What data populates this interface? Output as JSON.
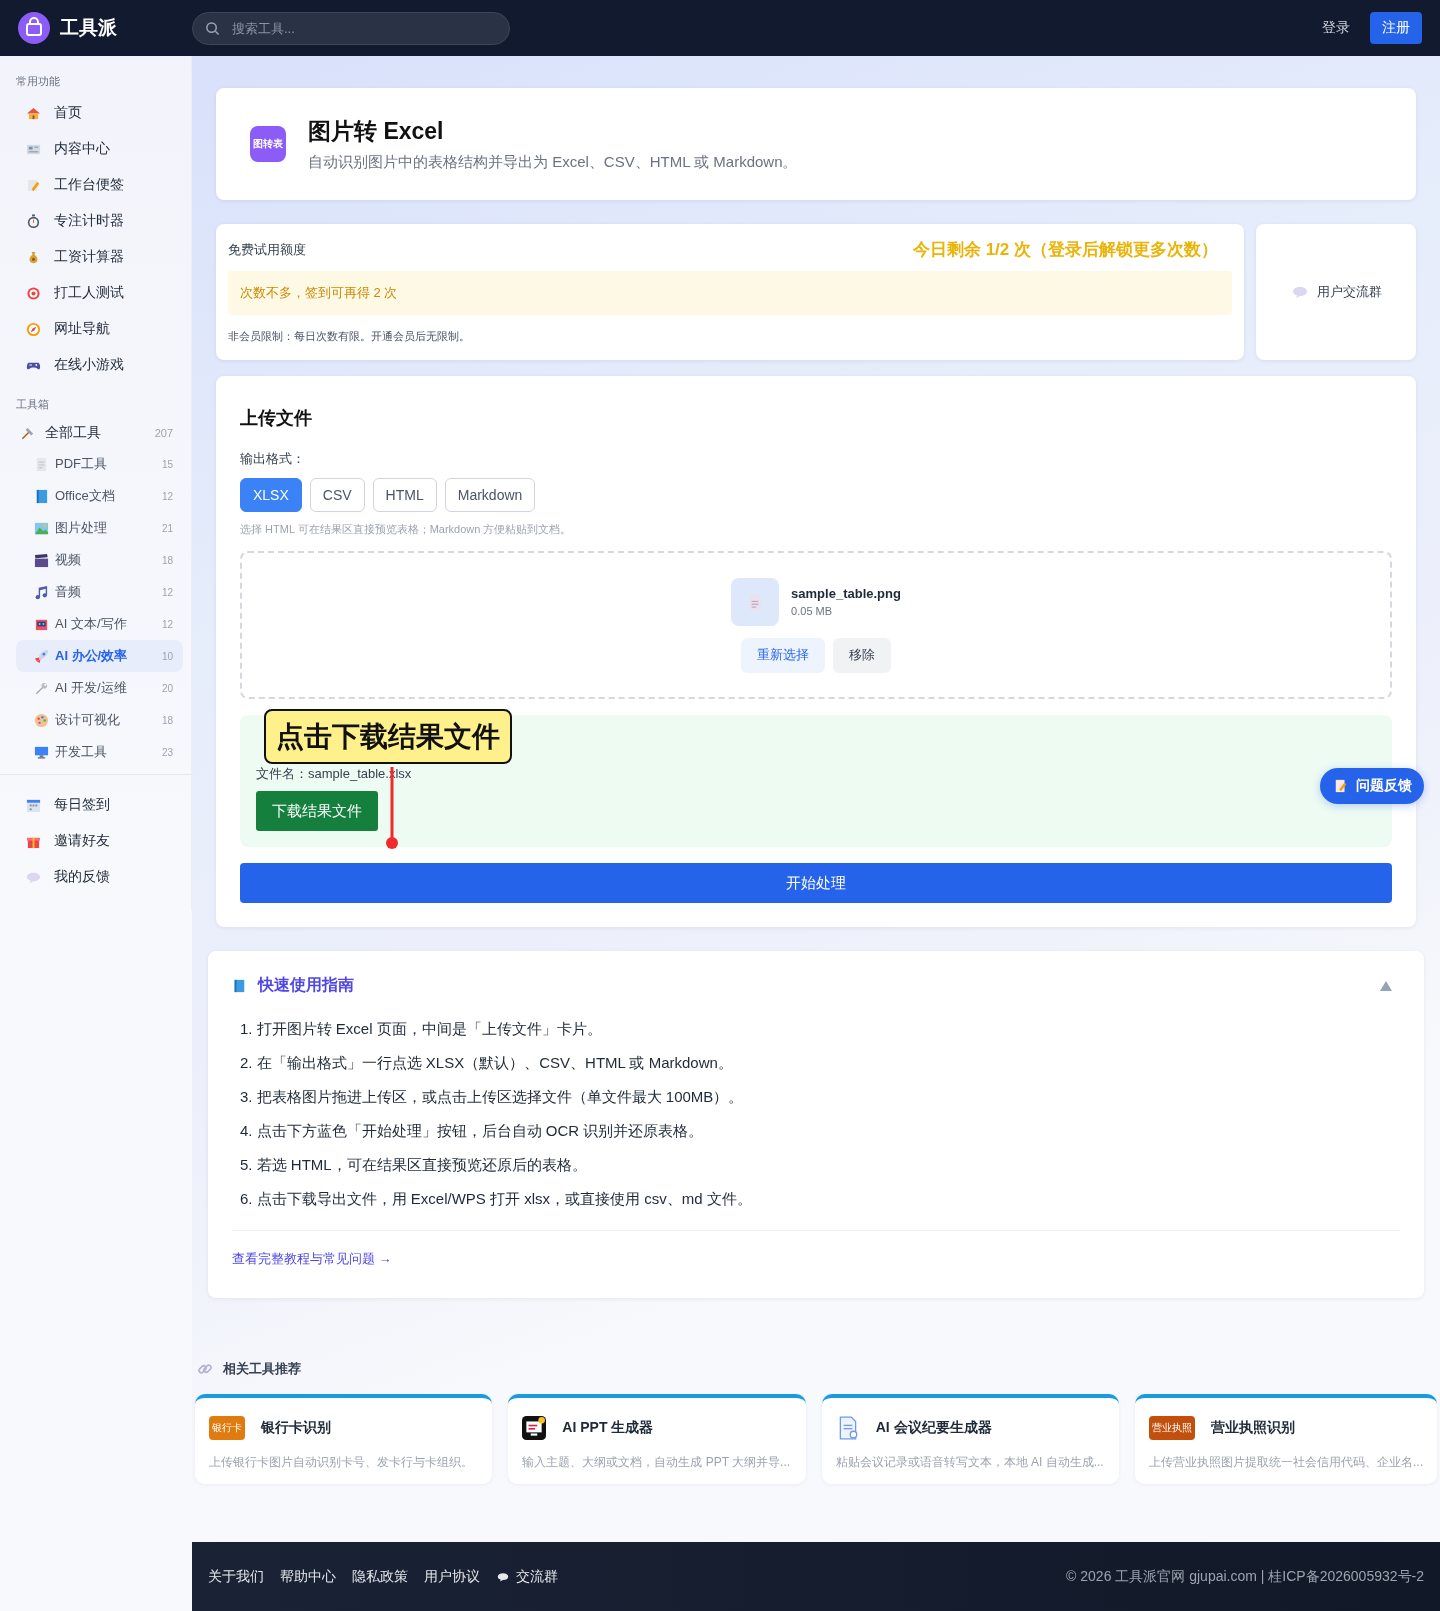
{
  "header": {
    "brand": "工具派",
    "search": {
      "placeholder": "搜索工具..."
    },
    "login": "登录",
    "register": "注册"
  },
  "sidebar": {
    "sections": [
      {
        "title": "常用功能",
        "items": [
          {
            "label": "首页",
            "selected": false
          },
          {
            "label": "内容中心",
            "selected": false
          },
          {
            "label": "工作台便签",
            "selected": false
          },
          {
            "label": "专注计时器",
            "selected": false
          },
          {
            "label": "工资计算器",
            "selected": false
          },
          {
            "label": "打工人测试",
            "selected": false
          },
          {
            "label": "网址导航",
            "selected": false
          },
          {
            "label": "在线小游戏",
            "selected": false
          }
        ]
      },
      {
        "title": "工具箱",
        "items": [
          {
            "label": "全部工具",
            "count": "207",
            "selected": false,
            "children": [
              {
                "label": "PDF工具",
                "count": "15",
                "selected": false
              },
              {
                "label": "Office文档",
                "count": "12",
                "selected": false
              },
              {
                "label": "图片处理",
                "count": "21",
                "selected": false
              },
              {
                "label": "视频",
                "count": "18",
                "selected": false
              },
              {
                "label": "音频",
                "count": "12",
                "selected": false
              },
              {
                "label": "AI 文本/写作",
                "count": "12",
                "selected": false
              },
              {
                "label": "AI 办公/效率",
                "count": "10",
                "selected": true
              },
              {
                "label": "AI 开发/运维",
                "count": "20",
                "selected": false
              },
              {
                "label": "设计可视化",
                "count": "18",
                "selected": false
              },
              {
                "label": "开发工具",
                "count": "23",
                "selected": false
              }
            ]
          }
        ]
      }
    ],
    "bottom_items": [
      {
        "label": "每日签到",
        "selected": false
      },
      {
        "label": "邀请好友",
        "selected": false
      },
      {
        "label": "我的反馈",
        "selected": false
      }
    ]
  },
  "tool": {
    "icon_text": "图转表",
    "title": "图片转 Excel",
    "description": "自动识别图片中的表格结构并导出为 Excel、CSV、HTML 或 Markdown。"
  },
  "quota": {
    "label": "免费试用额度",
    "remaining": "今日剩余 1/2 次（登录后解锁更多次数）",
    "notice": "次数不多，签到可再得 2 次",
    "note": "非会员限制：每日次数有限。开通会员后无限制。",
    "group_button": "用户交流群"
  },
  "upload": {
    "title": "上传文件",
    "format_label": "输出格式：",
    "formats": [
      {
        "label": "XLSX",
        "selected": true
      },
      {
        "label": "CSV",
        "selected": false
      },
      {
        "label": "HTML",
        "selected": false
      },
      {
        "label": "Markdown",
        "selected": false
      }
    ],
    "hint": "选择 HTML 可在结果区直接预览表格；Markdown 方便粘贴到文档。",
    "file": {
      "name": "sample_table.png",
      "size": "0.05 MB",
      "reselect": "重新选择",
      "remove": "移除"
    },
    "result": {
      "filename": "文件名：sample_table.xlsx",
      "download": "下载结果文件"
    },
    "callout": "点击下载结果文件",
    "start": "开始处理"
  },
  "feedback_button": "问题反馈",
  "guide": {
    "title": "快速使用指南",
    "expanded": true,
    "steps": [
      "1. 打开图片转 Excel 页面，中间是「上传文件」卡片。",
      "2. 在「输出格式」一行点选 XLSX（默认）、CSV、HTML 或 Markdown。",
      "3. 把表格图片拖进上传区，或点击上传区选择文件（单文件最大 100MB）。",
      "4. 点击下方蓝色「开始处理」按钮，后台自动 OCR 识别并还原表格。",
      "5. 若选 HTML，可在结果区直接预览还原后的表格。",
      "6. 点击下载导出文件，用 Excel/WPS 打开 xlsx，或直接使用 csv、md 文件。"
    ],
    "link": "查看完整教程与常见问题 →"
  },
  "related": {
    "title": "相关工具推荐",
    "cards": [
      {
        "kind": "badge",
        "icon_text": "银行卡",
        "title": "银行卡识别",
        "description": "上传银行卡图片自动识别卡号、发卡行与卡组织。"
      },
      {
        "kind": "icon",
        "title": "AI PPT 生成器",
        "description": "输入主题、大纲或文档，自动生成 PPT 大纲并导..."
      },
      {
        "kind": "icon",
        "title": "AI 会议纪要生成器",
        "description": "粘贴会议记录或语音转写文本，本地 AI 自动生成..."
      },
      {
        "kind": "badge",
        "icon_text": "营业执照",
        "title": "营业执照识别",
        "description": "上传营业执照图片提取统一社会信用代码、企业名..."
      }
    ]
  },
  "footer": {
    "links": [
      "关于我们",
      "帮助中心",
      "隐私政策",
      "用户协议",
      "交流群"
    ],
    "copyright": "© 2026 工具派官网 gjupai.com | 桂ICP备2026005932号-2"
  }
}
